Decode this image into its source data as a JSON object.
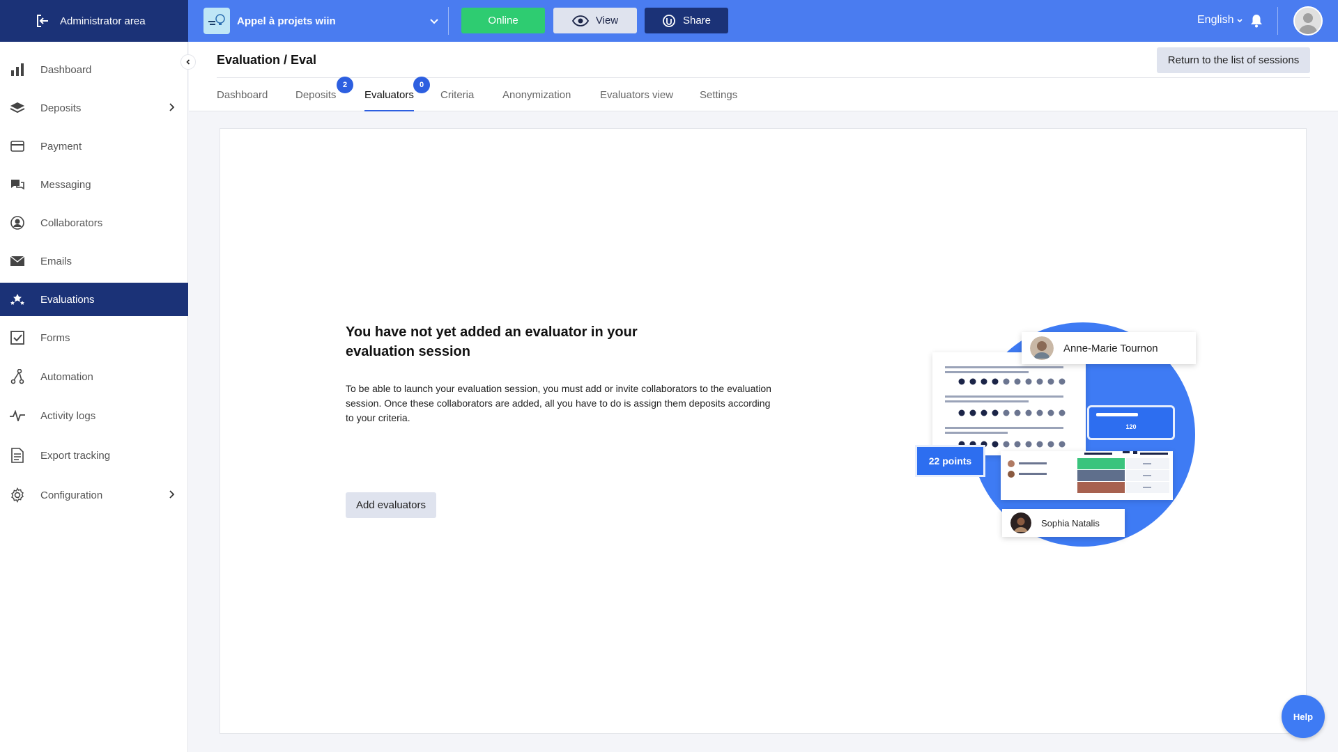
{
  "topbar": {
    "admin_label": "Administrator area",
    "project_name": "Appel à projets wiin",
    "online_label": "Online",
    "view_label": "View",
    "share_label": "Share",
    "language": "English",
    "colors": {
      "bar": "#4a7cf0",
      "dark": "#1b3277",
      "online": "#2ecc71"
    }
  },
  "sidebar": {
    "items": [
      {
        "label": "Dashboard",
        "icon": "bar-chart-icon"
      },
      {
        "label": "Deposits",
        "icon": "layers-icon",
        "has_arrow": true
      },
      {
        "label": "Payment",
        "icon": "credit-card-icon"
      },
      {
        "label": "Messaging",
        "icon": "chat-icon"
      },
      {
        "label": "Collaborators",
        "icon": "user-circle-icon"
      },
      {
        "label": "Emails",
        "icon": "envelope-icon"
      },
      {
        "label": "Evaluations",
        "icon": "stars-icon",
        "active": true
      },
      {
        "label": "Forms",
        "icon": "checkbox-icon"
      },
      {
        "label": "Automation",
        "icon": "automation-icon"
      },
      {
        "label": "Activity logs",
        "icon": "pulse-icon"
      },
      {
        "label": "Export tracking",
        "icon": "document-icon"
      },
      {
        "label": "Configuration",
        "icon": "gear-icon",
        "has_arrow": true
      }
    ]
  },
  "header": {
    "title": "Evaluation / Eval",
    "return_label": "Return to the list of sessions",
    "tabs": [
      {
        "label": "Dashboard"
      },
      {
        "label": "Deposits",
        "badge": "2"
      },
      {
        "label": "Evaluators",
        "badge": "0",
        "active": true
      },
      {
        "label": "Criteria"
      },
      {
        "label": "Anonymization"
      },
      {
        "label": "Evaluators view"
      },
      {
        "label": "Settings"
      }
    ]
  },
  "main": {
    "empty_title": "You have not yet added an evaluator in your evaluation session",
    "empty_text": "To be able to launch your evaluation session, you must add or invite collaborators to the evaluation session. Once these collaborators are added, all you have to do is assign them deposits according to your criteria.",
    "add_button": "Add evaluators",
    "illustration": {
      "name_top": "Anne-Marie Tournon",
      "name_bottom": "Sophia Natalis",
      "points": "22 points",
      "value": "120"
    }
  },
  "help_label": "Help"
}
